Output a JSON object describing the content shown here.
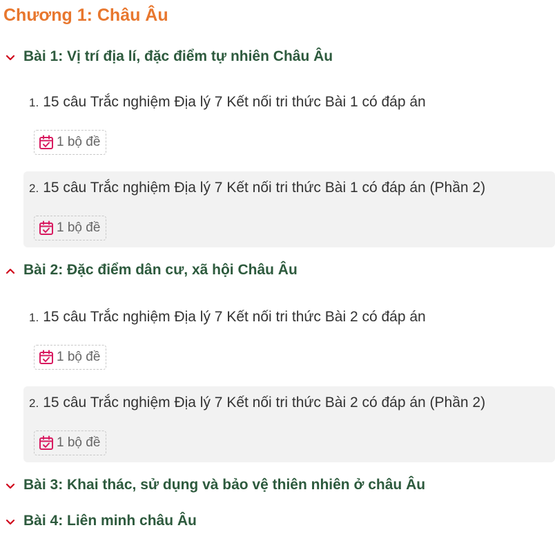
{
  "chapter": {
    "title": "Chương 1: Châu Âu"
  },
  "lessons": [
    {
      "title": "Bài 1: Vị trí địa lí, đặc điểm tự nhiên Châu Âu",
      "expanded": false,
      "items": [
        {
          "number": "1.",
          "title": "15 câu Trắc nghiệm Địa lý 7 Kết nối tri thức Bài 1 có đáp án",
          "badge": "1 bộ đề"
        },
        {
          "number": "2.",
          "title": "15 câu Trắc nghiệm Địa lý 7 Kết nối tri thức Bài 1 có đáp án (Phần 2)",
          "badge": "1 bộ đề"
        }
      ]
    },
    {
      "title": "Bài 2: Đặc điểm dân cư, xã hội Châu Âu",
      "expanded": true,
      "items": [
        {
          "number": "1.",
          "title": "15 câu Trắc nghiệm Địa lý 7 Kết nối tri thức Bài 2 có đáp án",
          "badge": "1 bộ đề"
        },
        {
          "number": "2.",
          "title": "15 câu Trắc nghiệm Địa lý 7 Kết nối tri thức Bài 2 có đáp án (Phần 2)",
          "badge": "1 bộ đề"
        }
      ]
    },
    {
      "title": "Bài 3: Khai thác, sử dụng và bảo vệ thiên nhiên ở châu Âu",
      "expanded": false
    },
    {
      "title": "Bài 4: Liên minh châu Âu",
      "expanded": false
    }
  ],
  "colors": {
    "chapter": "#e8772e",
    "lesson": "#2d5a3d",
    "chevron": "#d0021b",
    "calendar": "#d81b60"
  },
  "icons": {
    "chevron_collapsed": "chevron-down-icon",
    "chevron_expanded": "chevron-up-icon",
    "badge": "calendar-check-icon"
  }
}
